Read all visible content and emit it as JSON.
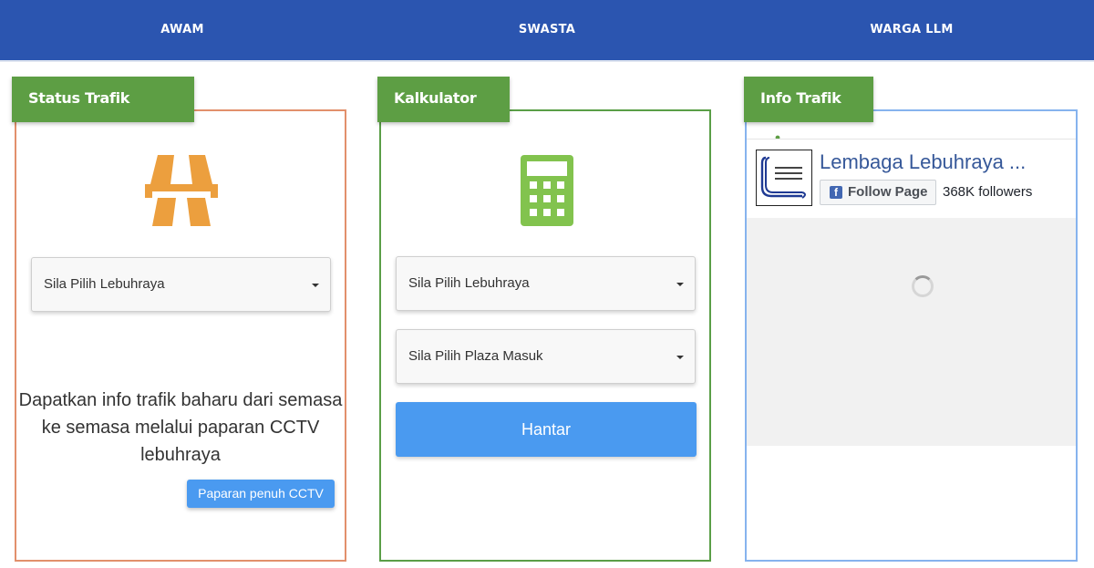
{
  "nav": {
    "tabs": [
      {
        "label": "AWAM"
      },
      {
        "label": "SWASTA"
      },
      {
        "label": "WARGA LLM"
      }
    ]
  },
  "status_panel": {
    "title": "Status Trafik Semasa",
    "icon": "highway-icon",
    "select_placeholder": "Sila Pilih Lebuhraya",
    "description": "Dapatkan info trafik baharu dari semasa ke semasa melalui paparan CCTV lebuhraya",
    "button_label": "Paparan penuh CCTV"
  },
  "calculator_panel": {
    "title": "Kalkulator Tol",
    "icon": "calculator-icon",
    "select_highway_placeholder": "Sila Pilih Lebuhraya",
    "select_plaza_placeholder": "Sila Pilih Plaza Masuk",
    "submit_label": "Hantar"
  },
  "info_panel": {
    "title": "Info Trafik",
    "icon": "map-pin-icon",
    "facebook": {
      "page_name": "Lembaga Lebuhraya ...",
      "follow_label": "Follow Page",
      "followers": "368K followers",
      "logo_text": "LEMBAGA LEBUHRAYA MALAYSIA"
    }
  },
  "colors": {
    "nav_bg": "#2b55b0",
    "panel_header_green": "#5d9e44",
    "button_blue": "#4a9af0",
    "highway_icon": "#ec9f3e",
    "calculator_icon": "#82c34e"
  }
}
